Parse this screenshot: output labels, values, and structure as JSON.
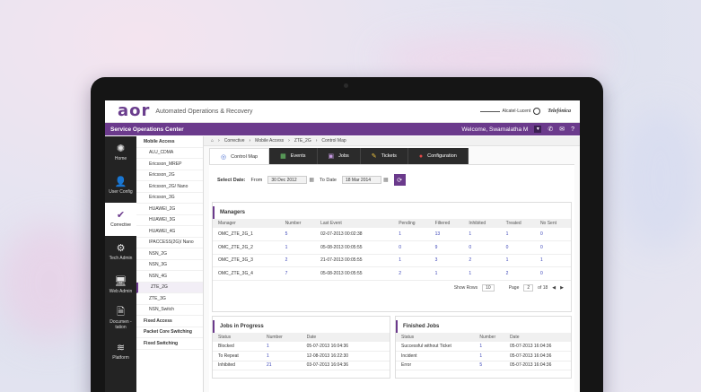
{
  "brand": {
    "logo": "aor",
    "app_title": "Automated Operations & Recovery",
    "partner1": "Alcatel·Lucent",
    "partner2": "Telefónica"
  },
  "topbar": {
    "center_name": "Service Operations Center",
    "welcome": "Welcome, Swarnalatha M"
  },
  "nav": [
    {
      "label": "Home",
      "icon": "gear-icon",
      "glyph": "✺"
    },
    {
      "label": "User Config",
      "icon": "user-icon",
      "glyph": "👤"
    },
    {
      "label": "Corrective",
      "icon": "check-icon",
      "glyph": "✔"
    },
    {
      "label": "Tech Admin",
      "icon": "tech-admin-icon",
      "glyph": "⚙"
    },
    {
      "label": "Web Admin",
      "icon": "monitor-icon",
      "glyph": "🖥"
    },
    {
      "label": "Documen -tation",
      "icon": "document-icon",
      "glyph": "🗎"
    },
    {
      "label": "Platform",
      "icon": "layers-icon",
      "glyph": "≋"
    }
  ],
  "tree": [
    {
      "label": "Mobile Access",
      "level": 0
    },
    {
      "label": "ALU_CDMA",
      "level": 1
    },
    {
      "label": "Ericsson_MREP",
      "level": 1
    },
    {
      "label": "Ericsson_2G",
      "level": 1
    },
    {
      "label": "Ericsson_2G/ Nano",
      "level": 1
    },
    {
      "label": "Ericsson_3G",
      "level": 1
    },
    {
      "label": "HUAWEI_2G",
      "level": 1
    },
    {
      "label": "HUAWEI_3G",
      "level": 1
    },
    {
      "label": "HUAWEI_4G",
      "level": 1
    },
    {
      "label": "IPACCESS(2G)/ Nano",
      "level": 1
    },
    {
      "label": "NSN_2G",
      "level": 1
    },
    {
      "label": "NSN_3G",
      "level": 1
    },
    {
      "label": "NSN_4G",
      "level": 1
    },
    {
      "label": "ZTE_2G",
      "level": 1,
      "selected": true
    },
    {
      "label": "ZTE_3G",
      "level": 1
    },
    {
      "label": "NSN_Switch",
      "level": 1
    },
    {
      "label": "Fixed Access",
      "level": 0
    },
    {
      "label": "Packet Core Switching",
      "level": 0
    },
    {
      "label": "Fixed Switching",
      "level": 0
    }
  ],
  "breadcrumb": [
    "Corrective",
    "Mobile Access",
    "ZTE_2G",
    "Control Map"
  ],
  "tabs": [
    {
      "label": "Control Map",
      "icon": "target-icon",
      "glyph": "◎",
      "cls": ""
    },
    {
      "label": "Events",
      "icon": "calendar-icon",
      "glyph": "▦",
      "cls": "green"
    },
    {
      "label": "Jobs",
      "icon": "briefcase-icon",
      "glyph": "▣",
      "cls": "purp"
    },
    {
      "label": "Tickets",
      "icon": "ticket-icon",
      "glyph": "✎",
      "cls": "yel"
    },
    {
      "label": "Configuration",
      "icon": "config-icon",
      "glyph": "●",
      "cls": "red"
    }
  ],
  "dates": {
    "select_label": "Select Date:",
    "from_label": "From",
    "from_value": "30 Dec 2012",
    "to_label": "To Date",
    "to_value": "18 Mar 2014"
  },
  "managers": {
    "title": "Managers",
    "columns": [
      "Manager",
      "Number",
      "Last Event",
      "Pending",
      "Filtered",
      "Inhibited",
      "Treated",
      "No Sent"
    ],
    "rows": [
      [
        "OMC_ZTE_2G_1",
        "5",
        "02-07-2013  00:02:38",
        "1",
        "13",
        "1",
        "1",
        "0"
      ],
      [
        "OMC_ZTE_2G_2",
        "1",
        "05-08-2013  00:05:55",
        "0",
        "9",
        "0",
        "0",
        "0"
      ],
      [
        "OMC_ZTE_3G_3",
        "2",
        "21-07-2013  00:05:55",
        "1",
        "3",
        "2",
        "1",
        "1"
      ],
      [
        "OMC_ZTE_3G_4",
        "7",
        "05-08-2013  00:05:55",
        "2",
        "1",
        "1",
        "2",
        "0"
      ]
    ],
    "show_rows_label": "Show Rows",
    "show_rows_value": "10",
    "page_label": "Page",
    "page_value": "2",
    "page_total": "of 18"
  },
  "jobs_in_progress": {
    "title": "Jobs in Progress",
    "columns": [
      "Status",
      "Number",
      "Date"
    ],
    "rows": [
      [
        "Blocked",
        "1",
        "05-07-2013  16:04:36"
      ],
      [
        "To Repeat",
        "1",
        "12-08-2013  16:22:30"
      ],
      [
        "Inhibited",
        "21",
        "03-07-2013  16:04:36"
      ]
    ]
  },
  "finished_jobs": {
    "title": "Finished Jobs",
    "columns": [
      "Status",
      "Number",
      "Date"
    ],
    "rows": [
      [
        "Successful without Ticket",
        "1",
        "05-07-2013  16:04:36"
      ],
      [
        "Incident",
        "1",
        "05-07-2013  16:04:36"
      ],
      [
        "Error",
        "5",
        "05-07-2013  16:04:36"
      ]
    ]
  }
}
